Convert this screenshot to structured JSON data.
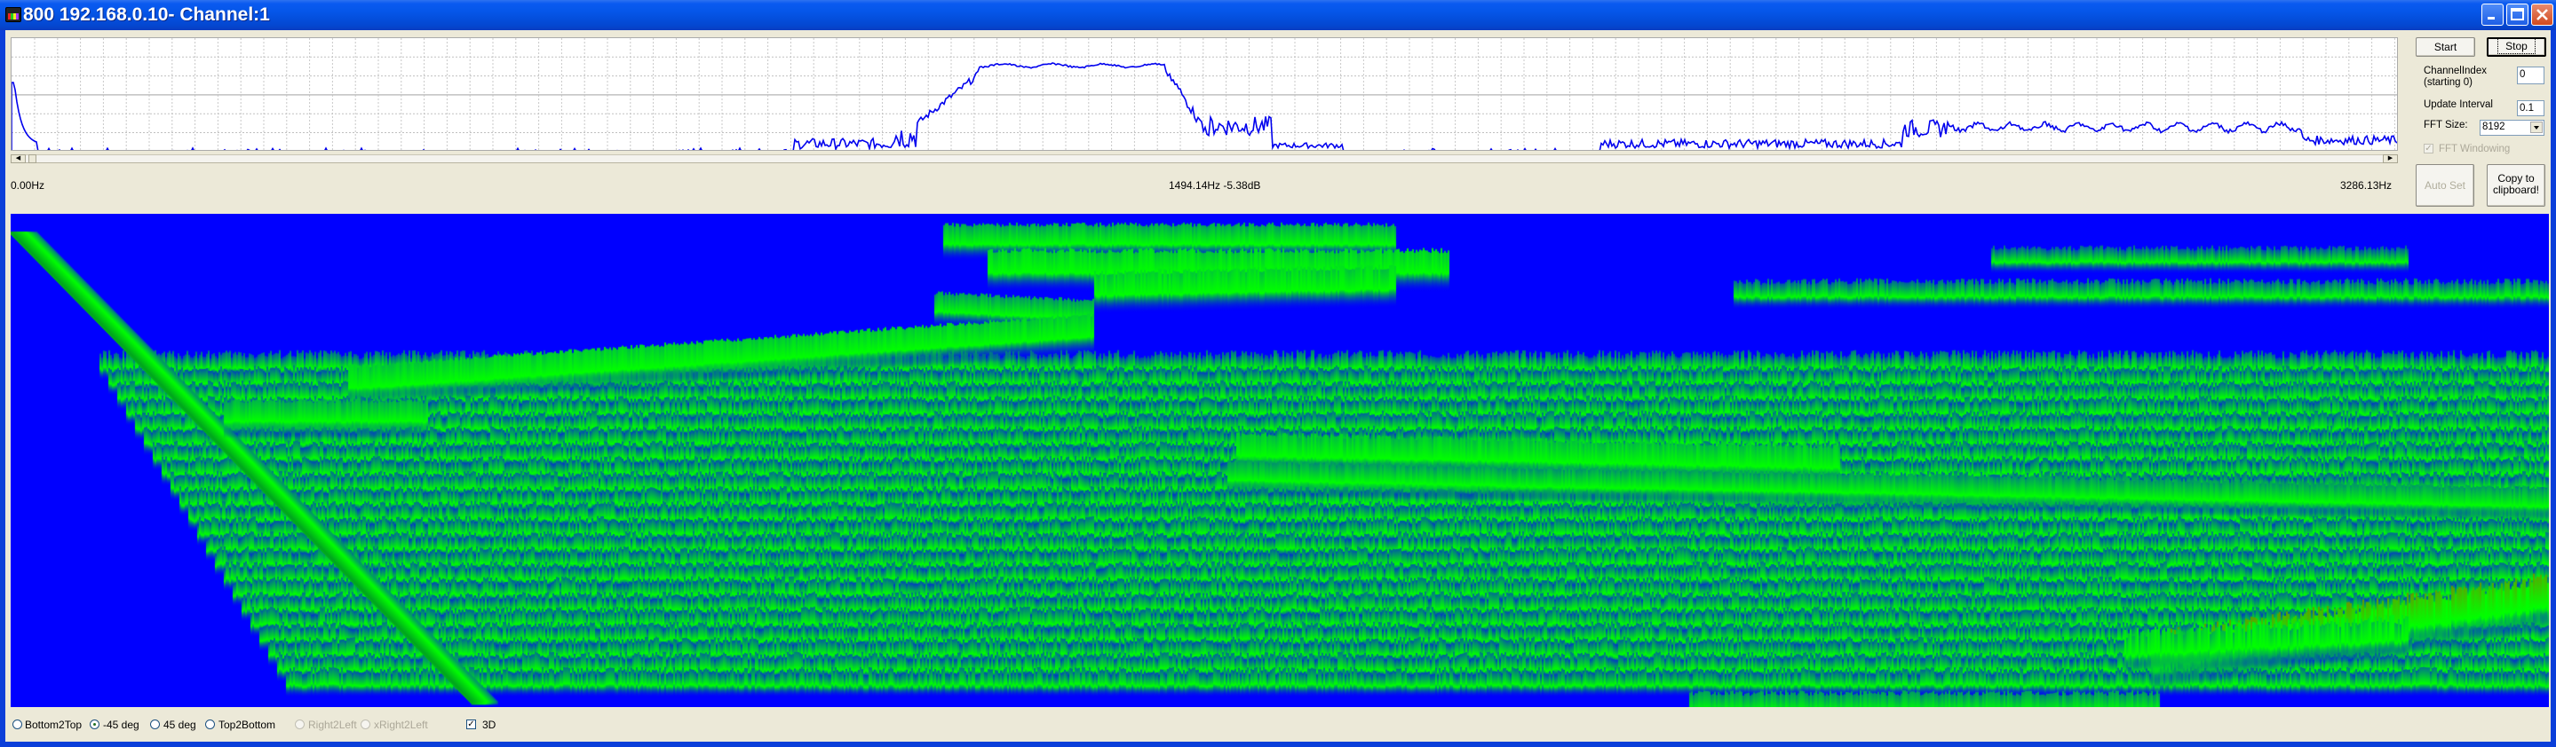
{
  "window": {
    "title": "800 192.168.0.10- Channel:1",
    "minimize_icon": "minimize-icon",
    "maximize_icon": "maximize-icon",
    "close_icon": "close-icon"
  },
  "spectrum": {
    "freq_start_label": "0.00Hz",
    "cursor_readout": "1494.14Hz -5.38dB",
    "freq_end_label": "3286.13Hz",
    "line_color": "#0000ee"
  },
  "controls": {
    "start_label": "Start",
    "stop_label": "Stop",
    "channel_index_label_line1": "ChannelIndex",
    "channel_index_label_line2": "(starting 0)",
    "channel_index_value": "0",
    "update_interval_label": "Update Interval",
    "update_interval_value": "0.1",
    "fft_size_label": "FFT Size:",
    "fft_size_value": "8192",
    "fft_windowing_label": "FFT Windowing",
    "fft_windowing_checked": true,
    "fft_windowing_enabled": false,
    "auto_set_label": "Auto Set",
    "copy_label_line1": "Copy to",
    "copy_label_line2": "clipboard!"
  },
  "waterfall": {
    "background_color": "#0000ff",
    "low_color": "#0000ff",
    "mid_color": "#00ff00",
    "high_color": "#ff0000"
  },
  "view_options": {
    "modes": [
      {
        "label": "Bottom2Top",
        "selected": false,
        "enabled": true
      },
      {
        "label": "-45 deg",
        "selected": true,
        "enabled": true
      },
      {
        "label": "45 deg",
        "selected": false,
        "enabled": true
      },
      {
        "label": "Top2Bottom",
        "selected": false,
        "enabled": true
      },
      {
        "label": "Right2Left",
        "selected": false,
        "enabled": false
      },
      {
        "label": "xRight2Left",
        "selected": false,
        "enabled": false
      }
    ],
    "three_d_label": "3D",
    "three_d_checked": true
  }
}
